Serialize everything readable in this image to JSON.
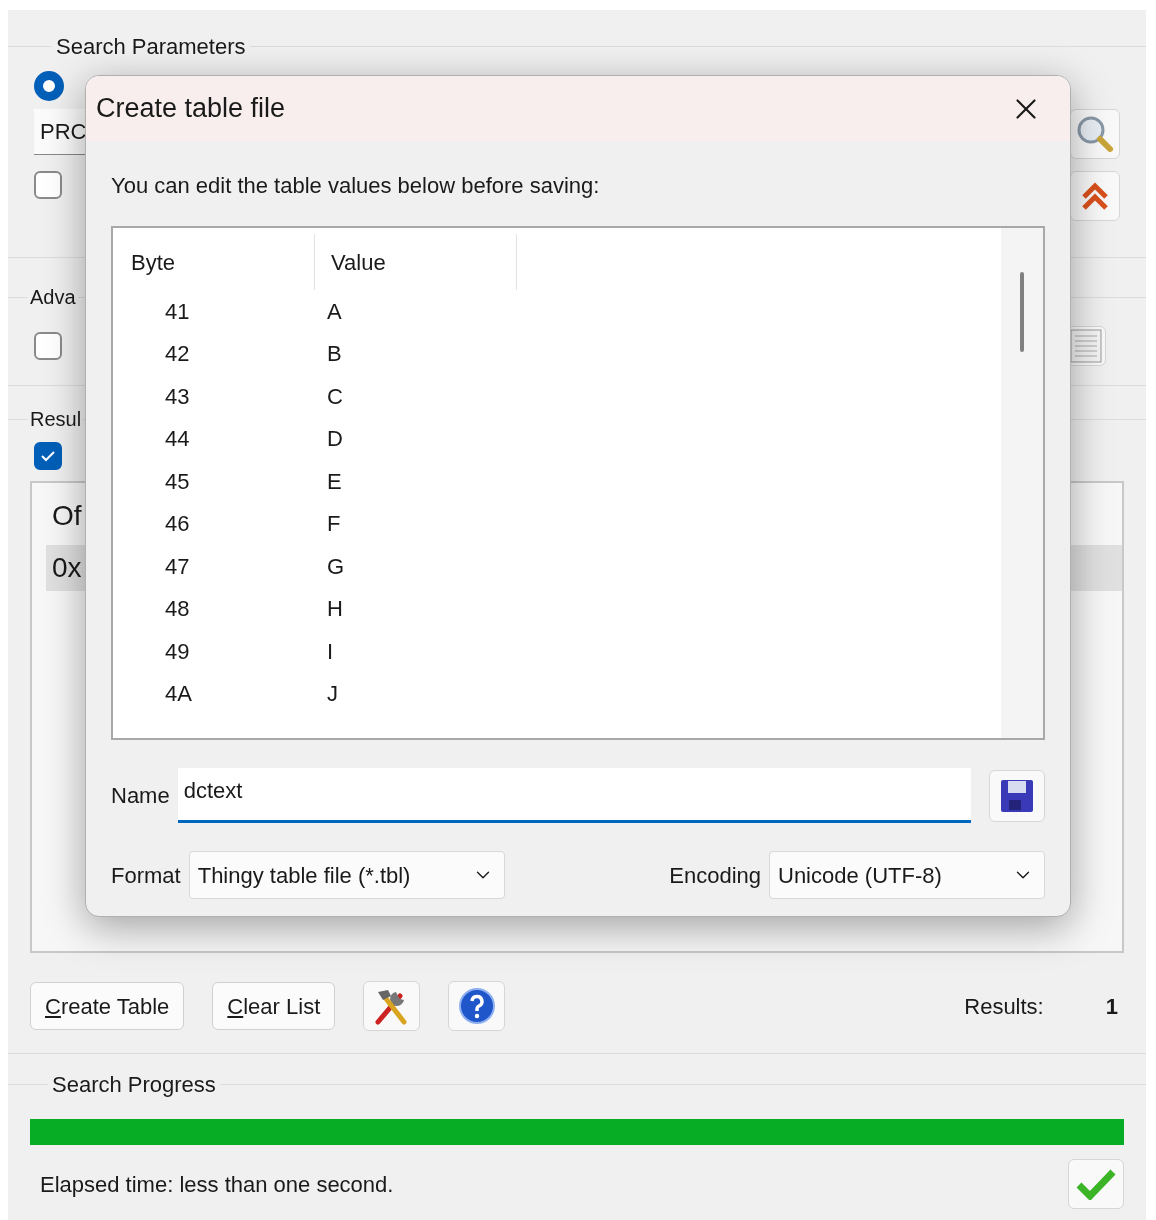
{
  "search_parameters": {
    "title": "Search Parameters",
    "radio": {
      "selected": true
    },
    "field": {
      "value": "PRC"
    },
    "checkbox": {
      "checked": false
    }
  },
  "advanced": {
    "title": "Adva",
    "checkbox": {
      "checked": false
    }
  },
  "results": {
    "title": "Resul",
    "checkbox": {
      "checked": true
    },
    "list": {
      "column_1": "Of",
      "rows": [
        {
          "cell": "0x",
          "selected": true
        }
      ]
    },
    "buttons": [
      {
        "label": "Create Table"
      },
      {
        "label": "Clear List"
      }
    ],
    "results_label": "Results:",
    "results_count": "1"
  },
  "progress": {
    "title": "Search Progress",
    "level": 1,
    "elapsed": "Elapsed time: less than one second."
  },
  "dialog": {
    "title": "Create table file",
    "message": "You can edit the table values below before saving:",
    "table": {
      "columns": [
        "Byte",
        "Value"
      ],
      "rows": [
        {
          "byte": "41",
          "value": "A"
        },
        {
          "byte": "42",
          "value": "B"
        },
        {
          "byte": "43",
          "value": "C"
        },
        {
          "byte": "44",
          "value": "D"
        },
        {
          "byte": "45",
          "value": "E"
        },
        {
          "byte": "46",
          "value": "F"
        },
        {
          "byte": "47",
          "value": "G"
        },
        {
          "byte": "48",
          "value": "H"
        },
        {
          "byte": "49",
          "value": "I"
        },
        {
          "byte": "4A",
          "value": "J"
        }
      ]
    },
    "name": {
      "label": "Name",
      "value": "dctext"
    },
    "format": {
      "label": "Format",
      "value": "Thingy table file (*.tbl)"
    },
    "encoding": {
      "label": "Encoding",
      "value": "Unicode (UTF-8)"
    }
  }
}
